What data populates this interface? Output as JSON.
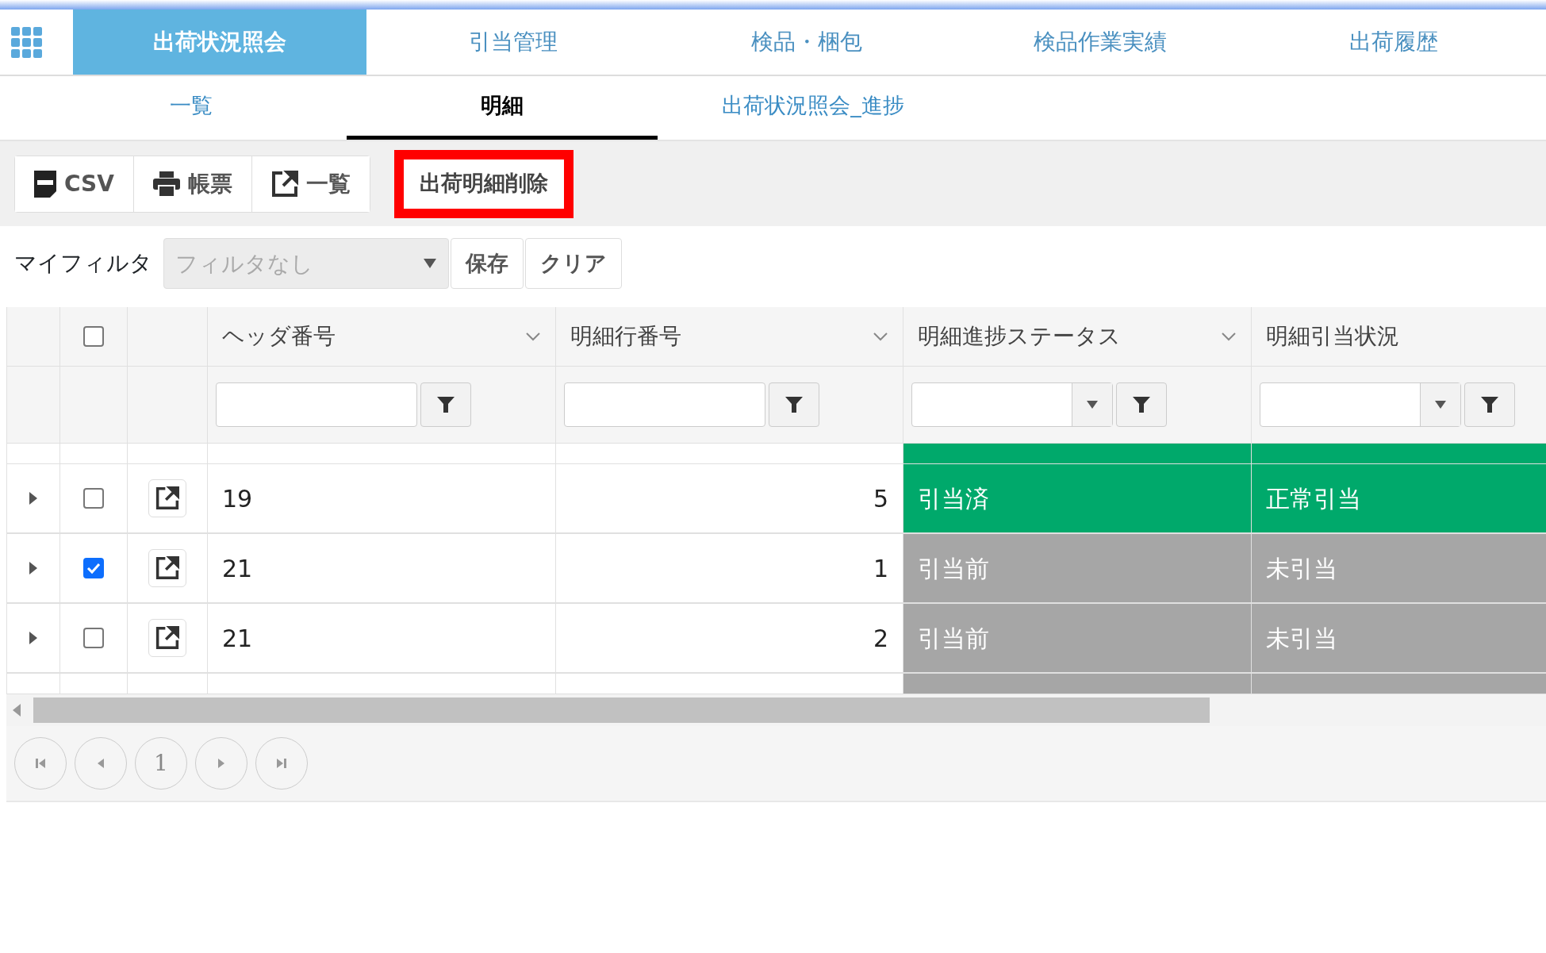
{
  "main_tabs": [
    {
      "label": "出荷状況照会",
      "selected": true
    },
    {
      "label": "引当管理",
      "selected": false
    },
    {
      "label": "検品・梱包",
      "selected": false
    },
    {
      "label": "検品作業実績",
      "selected": false
    },
    {
      "label": "出荷履歴",
      "selected": false
    }
  ],
  "sub_tabs": [
    {
      "label": "一覧",
      "selected": false
    },
    {
      "label": "明細",
      "selected": true
    },
    {
      "label": "出荷状況照会_進捗",
      "selected": false
    }
  ],
  "toolbar": {
    "buttons": [
      {
        "kind": "csv",
        "label": "CSV"
      },
      {
        "kind": "print",
        "label": "帳票"
      },
      {
        "kind": "open",
        "label": "一覧"
      }
    ],
    "delete_button": {
      "label": "出荷明細削除",
      "highlighted": true
    }
  },
  "my_filter": {
    "label": "マイフィルタ",
    "placeholder": "フィルタなし",
    "save": "保存",
    "clear": "クリア"
  },
  "grid": {
    "select_all_checked": false,
    "columns": [
      {
        "label": "ヘッダ番号",
        "kind": "text"
      },
      {
        "label": "明細行番号",
        "kind": "text"
      },
      {
        "label": "明細進捗ステータス",
        "kind": "select"
      },
      {
        "label": "明細引当状況",
        "kind": "select"
      }
    ],
    "rows": [
      {
        "kind": "partial",
        "color": "#00a96b"
      },
      {
        "kind": "full",
        "checked": false,
        "color": "#00a96b",
        "cells": [
          "19",
          "5",
          "引当済",
          "正常引当"
        ]
      },
      {
        "kind": "full",
        "checked": true,
        "color": "#a6a6a6",
        "cells": [
          "21",
          "1",
          "引当前",
          "未引当"
        ]
      },
      {
        "kind": "full",
        "checked": false,
        "color": "#a6a6a6",
        "cells": [
          "21",
          "2",
          "引当前",
          "未引当"
        ]
      },
      {
        "kind": "partial",
        "color": "#a6a6a6"
      }
    ]
  },
  "pager": {
    "page": "1"
  }
}
